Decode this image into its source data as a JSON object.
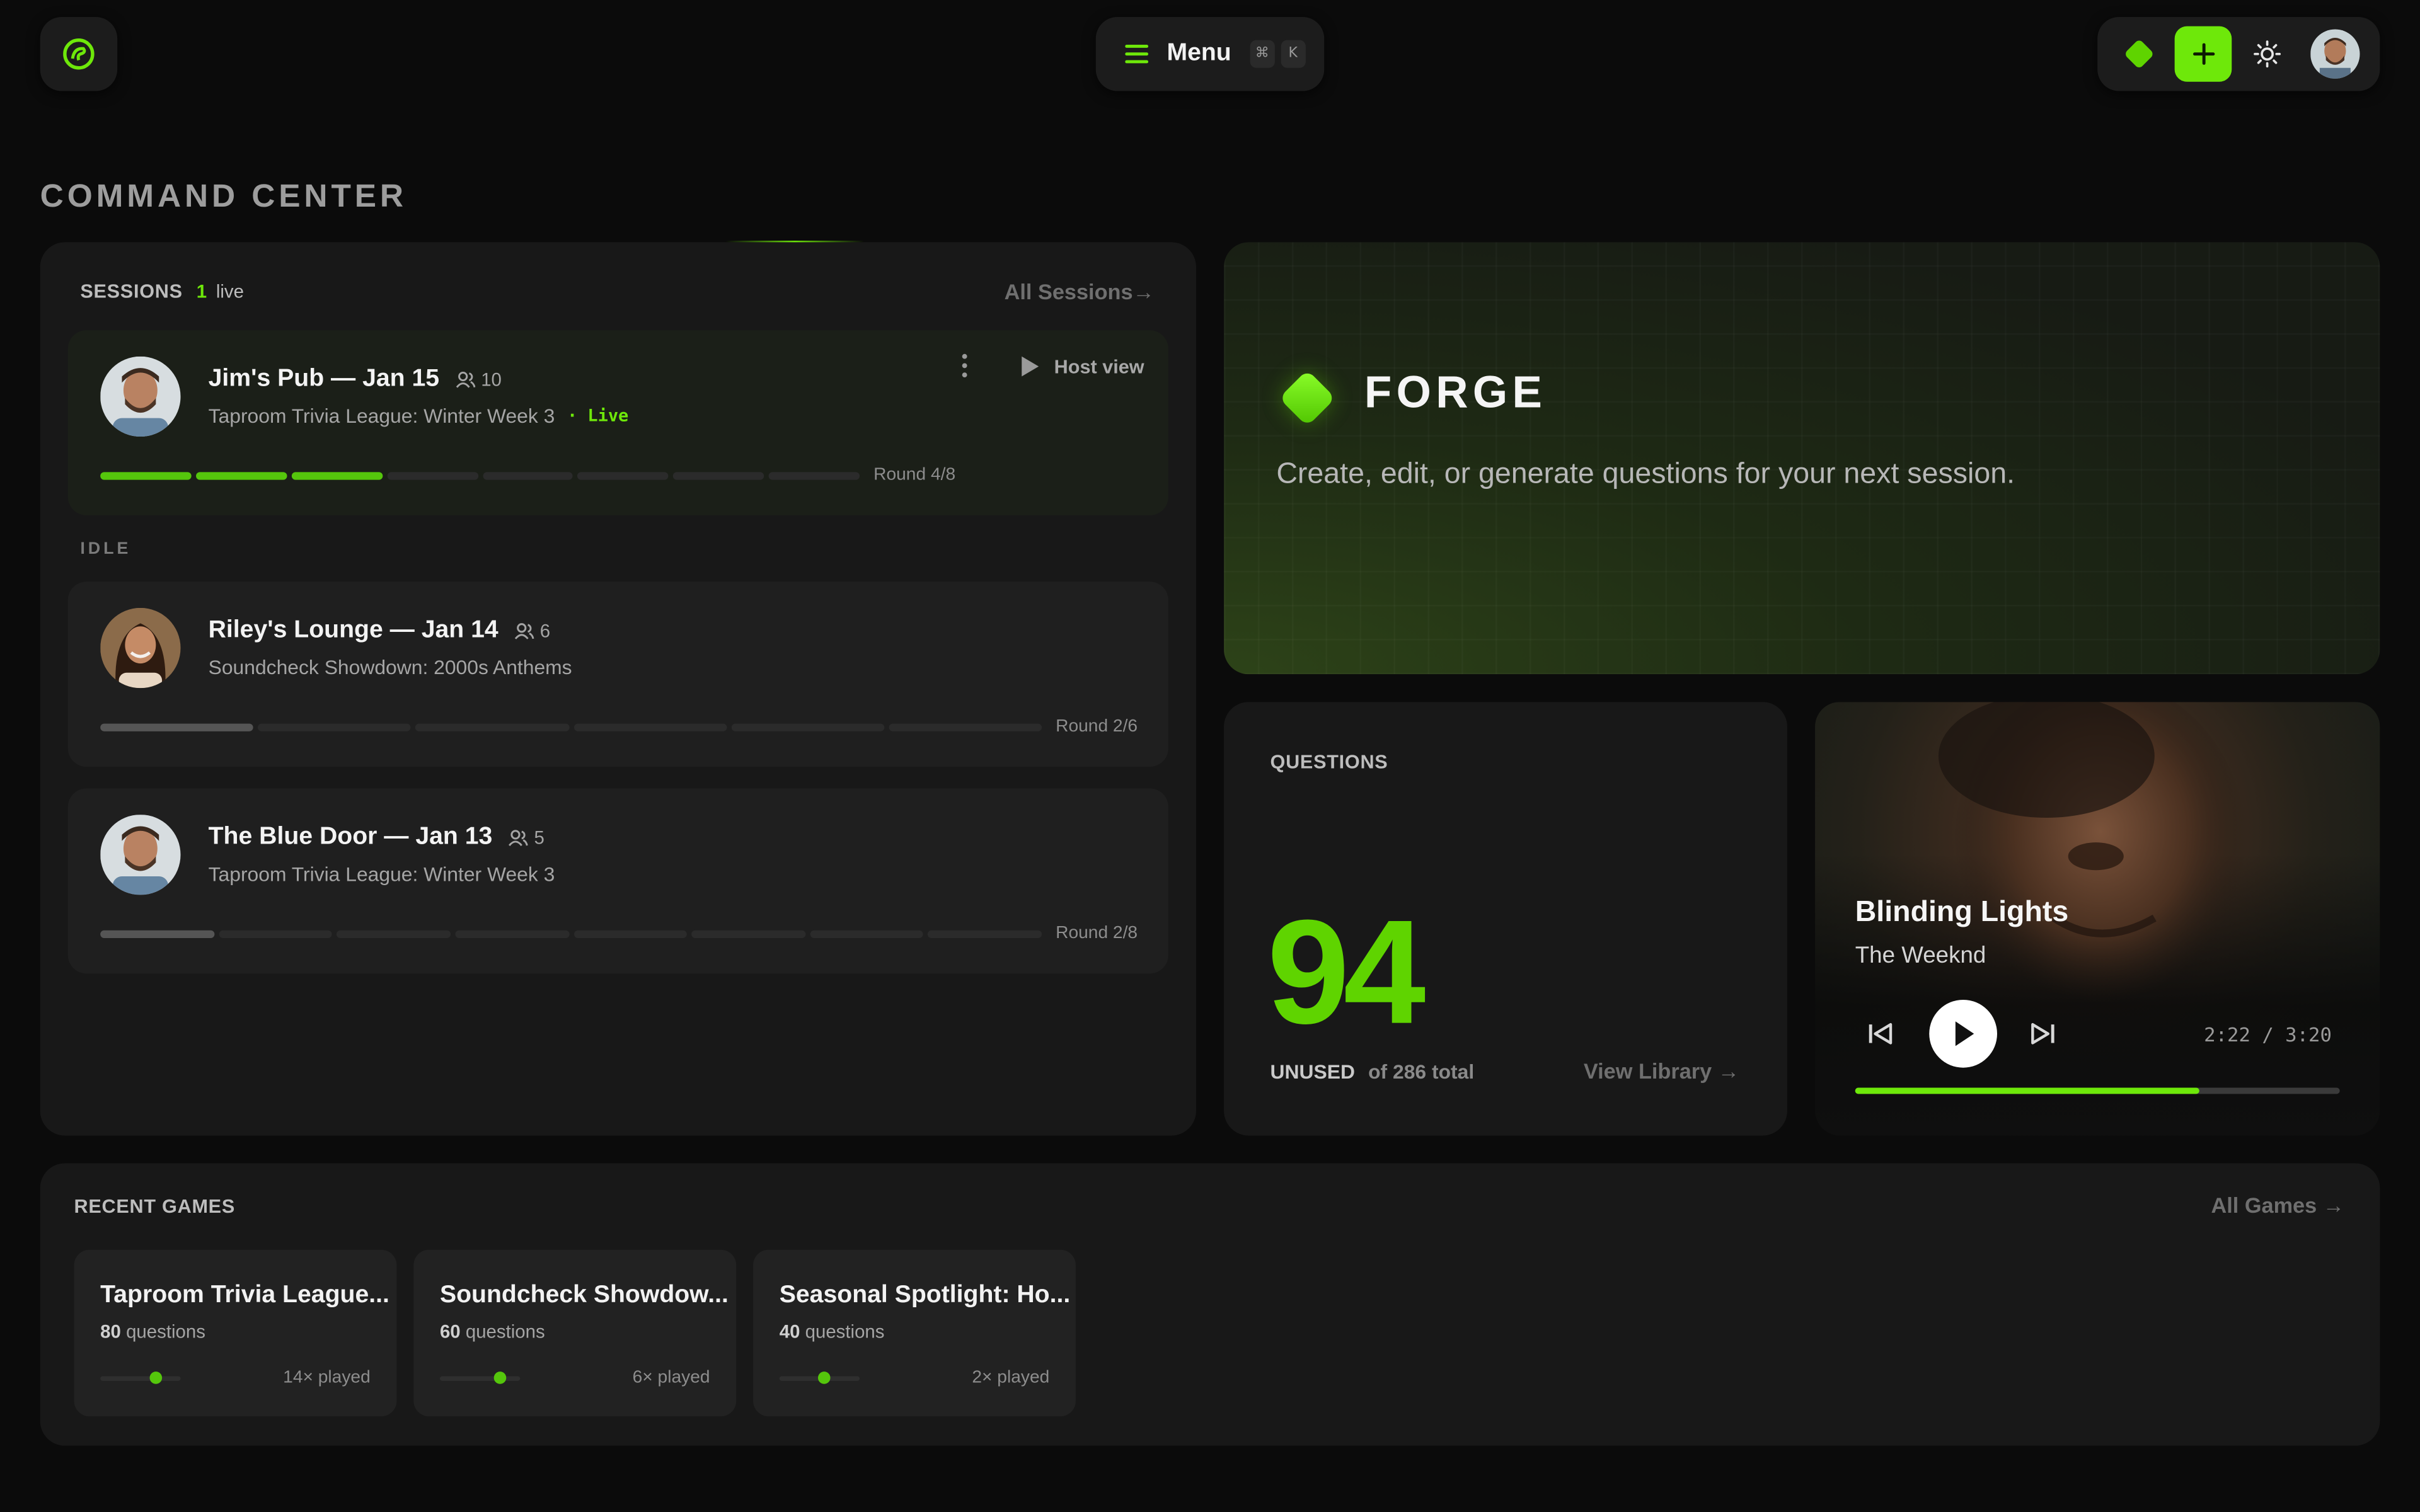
{
  "header": {
    "menu_label": "Menu",
    "kbd_cmd": "⌘",
    "kbd_key": "K"
  },
  "page_title": "COMMAND CENTER",
  "sessions": {
    "label": "SESSIONS",
    "live_count": "1",
    "live_word": "live",
    "all_link": "All Sessions→",
    "idle_label": "IDLE",
    "live": {
      "title": "Jim's Pub — Jan 15",
      "players": "10",
      "subtitle": "Taproom Trivia League: Winter Week 3",
      "status": "· Live",
      "host_view": "Host view",
      "round": "Round 4/8",
      "rounds_done": 3,
      "rounds_total": 8
    },
    "idle": [
      {
        "title": "Riley's Lounge — Jan 14",
        "players": "6",
        "subtitle": "Soundcheck Showdown: 2000s Anthems",
        "round": "Round 2/6",
        "rounds_done": 1,
        "rounds_total": 6
      },
      {
        "title": "The Blue Door — Jan 13",
        "players": "5",
        "subtitle": "Taproom Trivia League: Winter Week 3",
        "round": "Round 2/8",
        "rounds_done": 1,
        "rounds_total": 8
      }
    ]
  },
  "forge": {
    "title": "FORGE",
    "subtitle": "Create, edit, or generate questions for your next session."
  },
  "questions": {
    "label": "QUESTIONS",
    "unused_count": "94",
    "unused_label": "UNUSED",
    "total_text": "of 286 total",
    "view_link": "View Library →"
  },
  "player": {
    "title": "Blinding Lights",
    "artist": "The Weeknd",
    "time": "2:22 / 3:20",
    "progress_fraction": 0.71
  },
  "recent": {
    "label": "RECENT GAMES",
    "all_link": "All Games →",
    "games": [
      {
        "title": "Taproom Trivia League...",
        "count": "80",
        "count_label": "questions",
        "played": "14× played",
        "level": 0.7
      },
      {
        "title": "Soundcheck Showdow...",
        "count": "60",
        "count_label": "questions",
        "played": "6× played",
        "level": 0.75
      },
      {
        "title": "Seasonal Spotlight: Ho...",
        "count": "40",
        "count_label": "questions",
        "played": "2× played",
        "level": 0.55
      }
    ]
  },
  "colors": {
    "accent": "#6ee80a",
    "background": "#0b0b0b",
    "panel": "#181818"
  },
  "icons": [
    "logo-icon",
    "hamburger-icon",
    "diamond-icon",
    "plus-icon",
    "sun-icon",
    "users-icon",
    "kebab-icon",
    "play-icon",
    "previous-icon",
    "next-icon"
  ]
}
